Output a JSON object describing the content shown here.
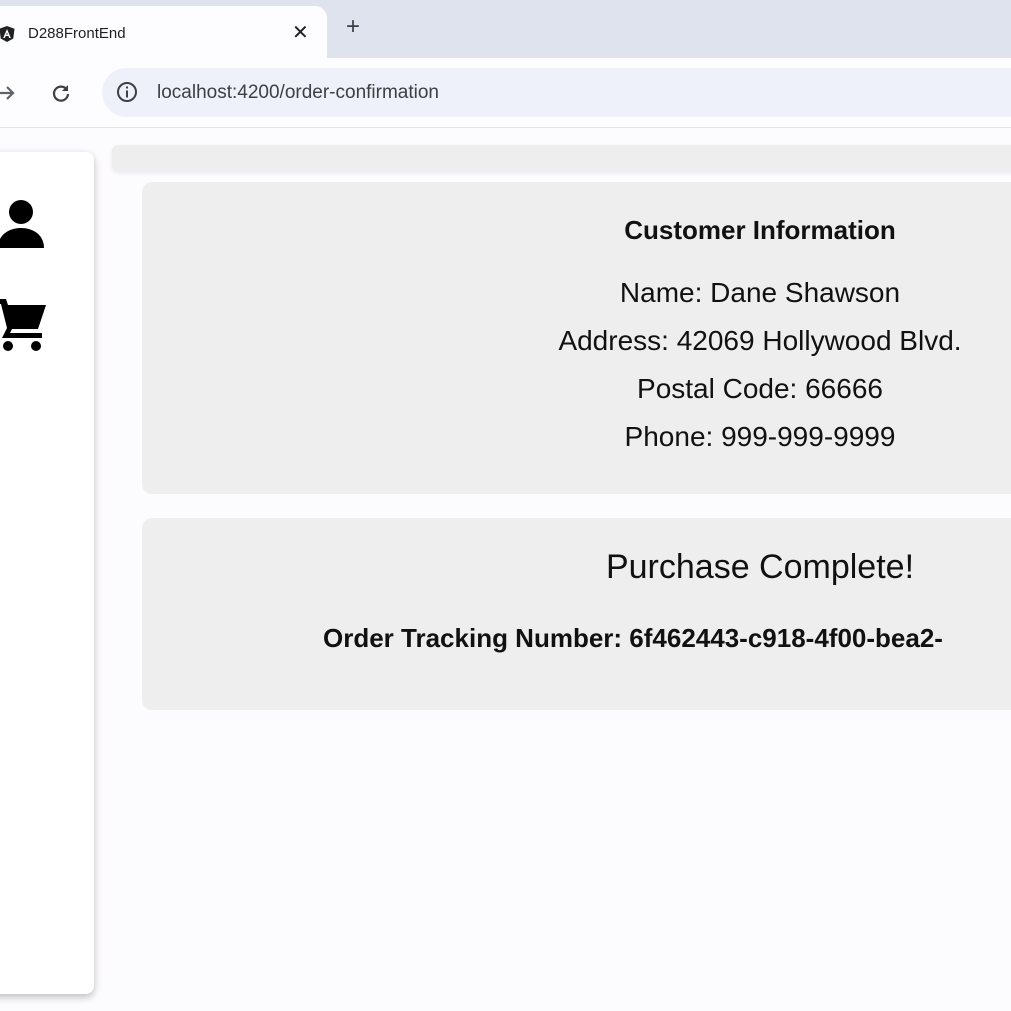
{
  "browser": {
    "tab_title": "D288FrontEnd",
    "close_glyph": "✕",
    "new_tab_glyph": "+",
    "url": "localhost:4200/order-confirmation"
  },
  "sidebar": {
    "items": [
      {
        "icon": "person-icon"
      },
      {
        "icon": "shopping-cart-icon"
      }
    ]
  },
  "customer": {
    "heading": "Customer Information",
    "name": "Name: Dane Shawson",
    "address": "Address: 42069 Hollywood Blvd.",
    "postal_code": "Postal Code: 66666",
    "phone": "Phone: 999-999-9999"
  },
  "purchase": {
    "heading": "Purchase Complete!",
    "tracking": "Order Tracking Number: 6f462443-c918-4f00-bea2-"
  }
}
